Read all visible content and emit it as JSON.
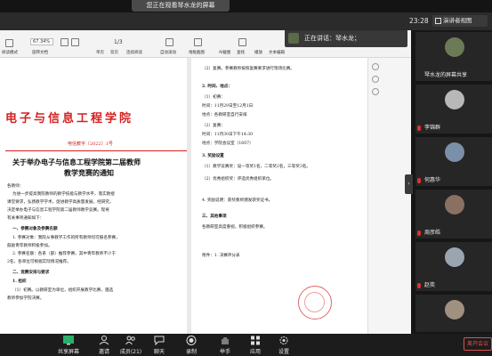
{
  "banner": {
    "share_text": "您正在观看琴水龙的屏幕"
  },
  "topbar": {
    "clock": "23:28",
    "gallery_label": "演讲者视图"
  },
  "speaker": {
    "text": "正在讲话：琴水龙；"
  },
  "wps": {
    "zoom": "67.34%",
    "page": "1/3",
    "tools": [
      "阅读模式",
      "旋转文档",
      "单页",
      "双页",
      "连续阅读",
      "自动滚动",
      "线框截图",
      "AI截图",
      "查找",
      "播放",
      "文本编辑",
      "编辑",
      "编辑"
    ]
  },
  "document": {
    "header": "电子与信息工程学院",
    "doc_number": "电信教字〔2022〕1号",
    "title_line1": "关于举办电子与信息工程学院第二届教师",
    "title_line2": "教学竞赛的通知",
    "left_paragraphs": [
      "各教师：",
      "为进一步提高我院教师的教学技能与教学水平，落实教授",
      "课堂要求，弘扬教学学术，促进教学高质量发展，经研究，",
      "决定举办电子与信息工程学院第二届教师教学竞赛。现将",
      "有关事项通知如下：",
      "一、参赛对象及参赛名额",
      "1. 参赛对象：我院从事教学工作的所有教师均可报名参赛，",
      "鼓励青年教师积极参加。",
      "2. 参赛名额：各系（部）推荐参赛，其中青年教师不少于",
      "2名，各单位可根据实际情况推荐。",
      "二、竞赛安排与要求",
      "1. 组织",
      "（1）初赛。以教研室为单位，组织开展教学比赛，遴选",
      "教师参加学院决赛。"
    ],
    "right_paragraphs": [
      "（2）复赛。参赛教师按照复赛要求进行现场比赛。",
      "2. 时间、地点：",
      "（1）初赛：",
      "时间：11月29日至12月1日",
      "地点：各教研室自行安排",
      "（2）复赛：",
      "时间：11月30日下午14:30",
      "地点：学院会议室（1607）",
      "3. 奖励设置",
      "（1）教学竞赛奖：设一等奖1名，二等奖2名，三等奖3名。",
      "（2）优秀组织奖：评选优秀组织单位。",
      "4. 奖励说明：获奖教师颁发获奖证书。",
      "三、其他事项",
      "各教研室高度重视，积极组织参赛。",
      "附件：1. 决赛评分表"
    ]
  },
  "participants": [
    {
      "name": "琴水龙的屏幕共享",
      "color": "#6d7a58"
    },
    {
      "name": "李锦群",
      "color": "#b8b8b8"
    },
    {
      "name": "何惠华",
      "color": "#7a8fa8"
    },
    {
      "name": "周彦皓",
      "color": "#8a7060"
    },
    {
      "name": "赵奕",
      "color": "#9aa5b0"
    },
    {
      "name": "",
      "color": "#a09080"
    }
  ],
  "controls": {
    "share": "共享屏幕",
    "invite": "邀请",
    "members": "成员(21)",
    "chat": "聊天",
    "record": "录制",
    "raise": "举手",
    "apps": "应用",
    "settings": "设置",
    "end": "离开会议"
  }
}
